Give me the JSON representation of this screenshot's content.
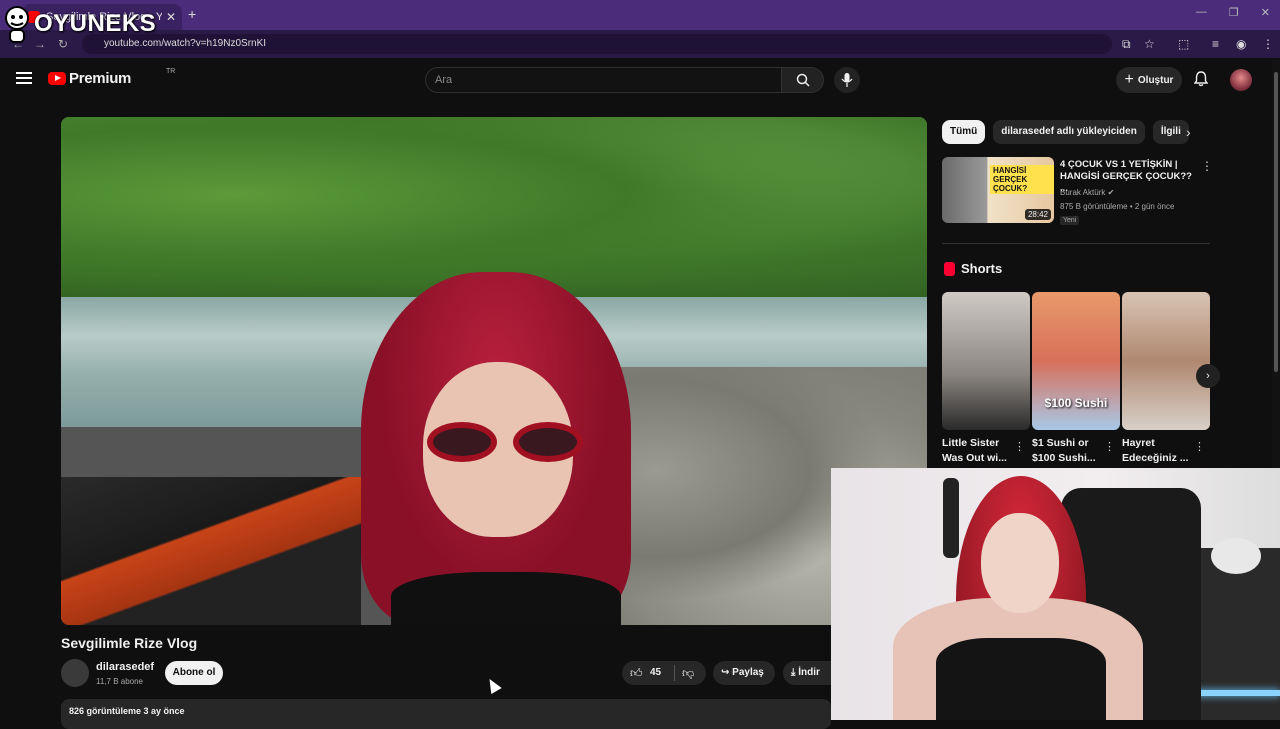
{
  "browser": {
    "tab_title": "Sevgilimle Rize Vlog - YouTube",
    "url": "youtube.com/watch?v=h19Nz0SrnKI"
  },
  "overlay_logo": "OYUNEKS",
  "header": {
    "logo_text": "Premium",
    "region": "TR",
    "search_placeholder": "Ara",
    "create_label": "Oluştur"
  },
  "video": {
    "title": "Sevgilimle Rize Vlog",
    "channel": "dilarasedef",
    "subscribers": "11,7 B abone",
    "subscribe_label": "Abone ol",
    "likes": "45",
    "share_label": "Paylaş",
    "download_label": "İndir",
    "views": "826 görüntüleme  3 ay önce"
  },
  "sidebar": {
    "chips": [
      "Tümü",
      "dilarasedef adlı yükleyiciden",
      "İlgili"
    ],
    "recommended": {
      "title": "4 ÇOCUK VS 1 YETİŞKİN | HANGİSİ GERÇEK ÇOCUK?? ...",
      "channel": "Burak Aktürk",
      "meta": "875 B görüntüleme • 2 gün önce",
      "badge": "Yeni",
      "duration": "28:42",
      "thumb_text": "HANGİSİ GERÇEK ÇOCUK?"
    },
    "shorts_heading": "Shorts",
    "shorts": [
      {
        "title": "Little Sister Was Out wi...",
        "caption": ""
      },
      {
        "title": "$1 Sushi or $100 Sushi...",
        "caption": "$100 Sushi"
      },
      {
        "title": "Hayret Edeceğiniz ...",
        "caption": ""
      }
    ]
  }
}
